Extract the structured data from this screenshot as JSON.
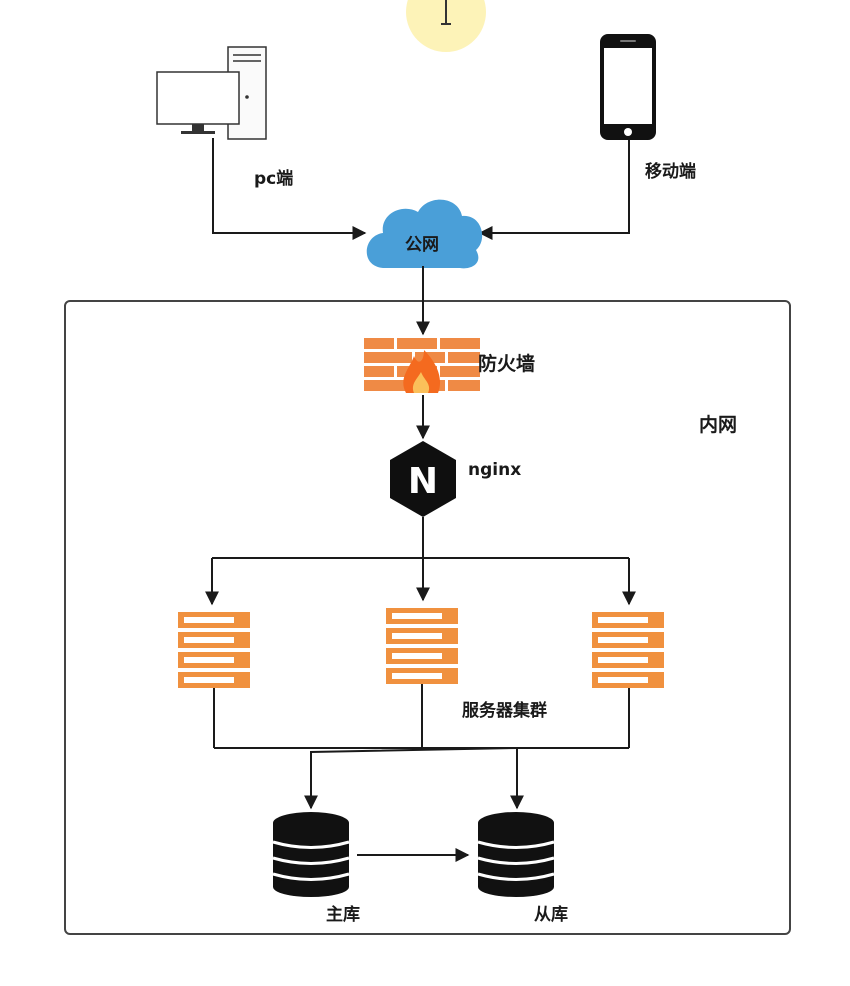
{
  "labels": {
    "pc": "pc端",
    "mobile": "移动端",
    "internet": "公网",
    "firewall": "防火墙",
    "intranet": "内网",
    "nginx": "nginx",
    "nginx_glyph": "N",
    "server_cluster": "服务器集群",
    "master_db": "主库",
    "slave_db": "从库"
  },
  "icons": {
    "pc": "desktop-computer-icon",
    "mobile": "smartphone-icon",
    "internet": "cloud-icon",
    "firewall": "firewall-icon",
    "nginx": "nginx-hexagon-icon",
    "server": "server-rack-icon",
    "database": "database-icon",
    "cursor": "text-cursor-icon"
  },
  "colors": {
    "line": "#1a1a1a",
    "cloud": "#4a9fd8",
    "firewall_brick": "#ef8a45",
    "firewall_flame": "#f46a1f",
    "server_orange": "#f0913f",
    "db_black": "#111111",
    "cursor_highlight": "#fdf3b8"
  }
}
